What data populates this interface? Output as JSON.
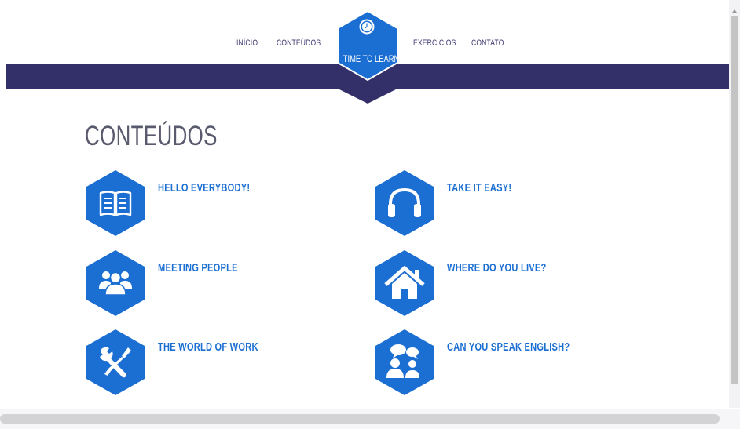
{
  "nav": {
    "items": [
      "INÍCIO",
      "CONTEÚDOS",
      "EXERCÍCIOS",
      "CONTATO"
    ],
    "logo_text": "TIME TO LEARN"
  },
  "page": {
    "title": "CONTEÚDOS"
  },
  "topics": [
    {
      "label": "HELLO EVERYBODY!",
      "icon": "book-icon"
    },
    {
      "label": "TAKE IT EASY!",
      "icon": "headphones-icon"
    },
    {
      "label": "MEETING PEOPLE",
      "icon": "people-group-icon"
    },
    {
      "label": "WHERE DO YOU LIVE?",
      "icon": "home-icon"
    },
    {
      "label": "THE WORLD OF WORK",
      "icon": "tools-icon"
    },
    {
      "label": "CAN YOU SPEAK ENGLISH?",
      "icon": "speaking-people-icon"
    }
  ],
  "colors": {
    "brand": "#1c6fd2",
    "band": "#332f68",
    "nav_text": "#3e3a72",
    "title": "#5a5a6e"
  }
}
